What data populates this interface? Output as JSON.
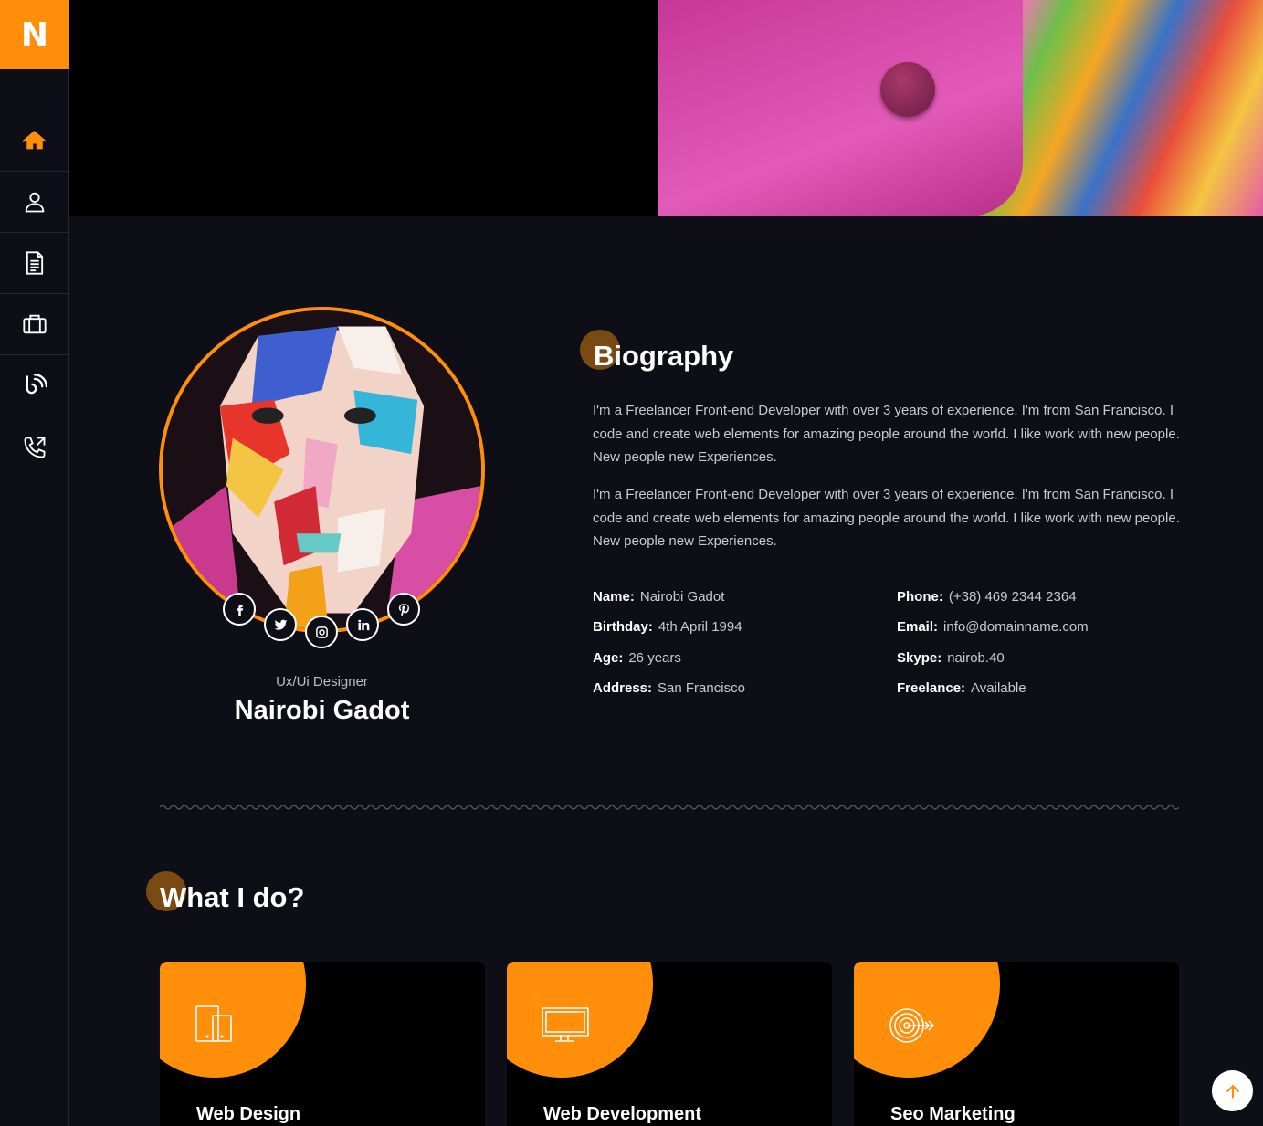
{
  "brand": {
    "logo_letter": "N",
    "accent": "#ff8f0a"
  },
  "nav": [
    {
      "icon": "home-icon",
      "active": true
    },
    {
      "icon": "user-icon"
    },
    {
      "icon": "document-icon"
    },
    {
      "icon": "briefcase-icon"
    },
    {
      "icon": "blog-icon"
    },
    {
      "icon": "phone-icon"
    }
  ],
  "profile": {
    "role": "Ux/Ui Designer",
    "name": "Nairobi Gadot",
    "socials": [
      "facebook-icon",
      "twitter-icon",
      "instagram-icon",
      "linkedin-icon",
      "pinterest-icon"
    ]
  },
  "biography": {
    "heading": "Biography",
    "paragraphs": [
      "I'm a Freelancer Front-end Developer with over 3 years of experience. I'm from San Francisco. I code and create web elements for amazing people around the world. I like work with new people. New people new Experiences.",
      "I'm a Freelancer Front-end Developer with over 3 years of experience. I'm from San Francisco. I code and create web elements for amazing people around the world. I like work with new people. New people new Experiences."
    ],
    "info_left": [
      {
        "label": "Name:",
        "value": "Nairobi Gadot"
      },
      {
        "label": "Birthday:",
        "value": "4th April 1994"
      },
      {
        "label": "Age:",
        "value": "26 years"
      },
      {
        "label": "Address:",
        "value": "San Francisco"
      }
    ],
    "info_right": [
      {
        "label": "Phone:",
        "value": "(+38) 469 2344 2364"
      },
      {
        "label": "Email:",
        "value": "info@domainname.com"
      },
      {
        "label": "Skype:",
        "value": "nairob.40"
      },
      {
        "label": "Freelance:",
        "value": "Available"
      }
    ]
  },
  "services": {
    "heading": "What I do?",
    "items": [
      {
        "title": "Web Design",
        "icon": "devices-icon"
      },
      {
        "title": "Web Development",
        "icon": "monitor-icon"
      },
      {
        "title": "Seo Marketing",
        "icon": "target-icon"
      }
    ]
  }
}
